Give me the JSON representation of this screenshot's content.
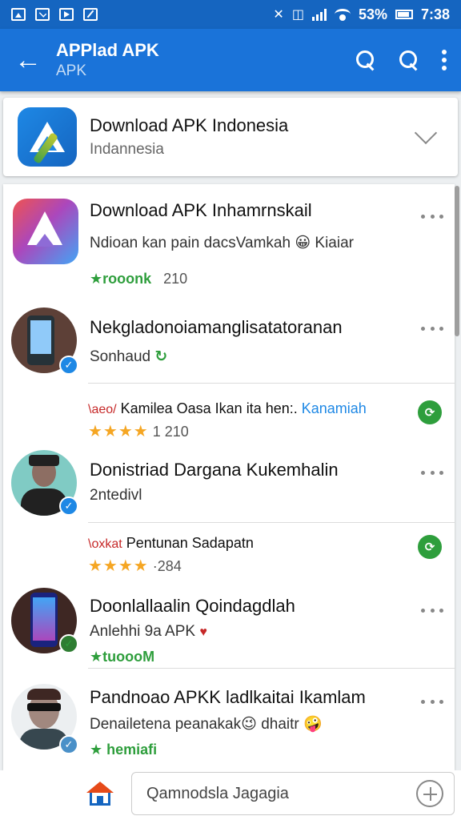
{
  "status_bar": {
    "left_icons": [
      "picture-icon",
      "mail-icon",
      "play-icon",
      "edit-icon"
    ],
    "battery_percent": "53%",
    "time": "7:38"
  },
  "app_bar": {
    "title": "APPlad APK",
    "subtitle": "APK"
  },
  "header_card": {
    "title": "Download APK Indonesia",
    "subtitle": "Indannesia"
  },
  "list": [
    {
      "title": "Download APK Inhamrnskail",
      "subtitle": "Ndioan kan pain dacsVamkah",
      "emoji": "😀",
      "suffix": "Kiaiar",
      "meta_green": "★rooonk",
      "meta_gray": "210"
    },
    {
      "title": "Nekgladonoiamanglisatatoranan",
      "subtitle": "Sonhaud"
    },
    {
      "prefix": "\\aeo/",
      "text": "Kamilea Oasa Ikan ita hen:.",
      "link": "Kanamiah",
      "stars": "★★★★",
      "rating_count": "1 210"
    },
    {
      "title": "Donistriad Dargana Kukemhalin",
      "subtitle": "2ntedivl"
    },
    {
      "prefix": "\\oxkat",
      "text": "Pentunan Sadapatn",
      "stars": "★★★★",
      "rating_count": "·284"
    },
    {
      "title": "Doonlallaalin Qoindagdlah",
      "subtitle": "Anlehhi 9a APK",
      "emoji": "♥",
      "meta_green": "★tuoooM"
    },
    {
      "title": "Pandnoao APKK ladlkaitai Ikamlam",
      "subtitle": "Denailetena peanakak",
      "mid_emoji": "😉",
      "suffix": "dhaitr",
      "emoji": "🤪",
      "meta_green": "★ hemiafi"
    }
  ],
  "bottom_bar": {
    "search_placeholder": "Qamnodsla Jagagia"
  },
  "colors": {
    "status_bar": "#1565c0",
    "app_bar": "#1a73d9",
    "accent_green": "#2e9e3c",
    "star": "#f5a623"
  }
}
